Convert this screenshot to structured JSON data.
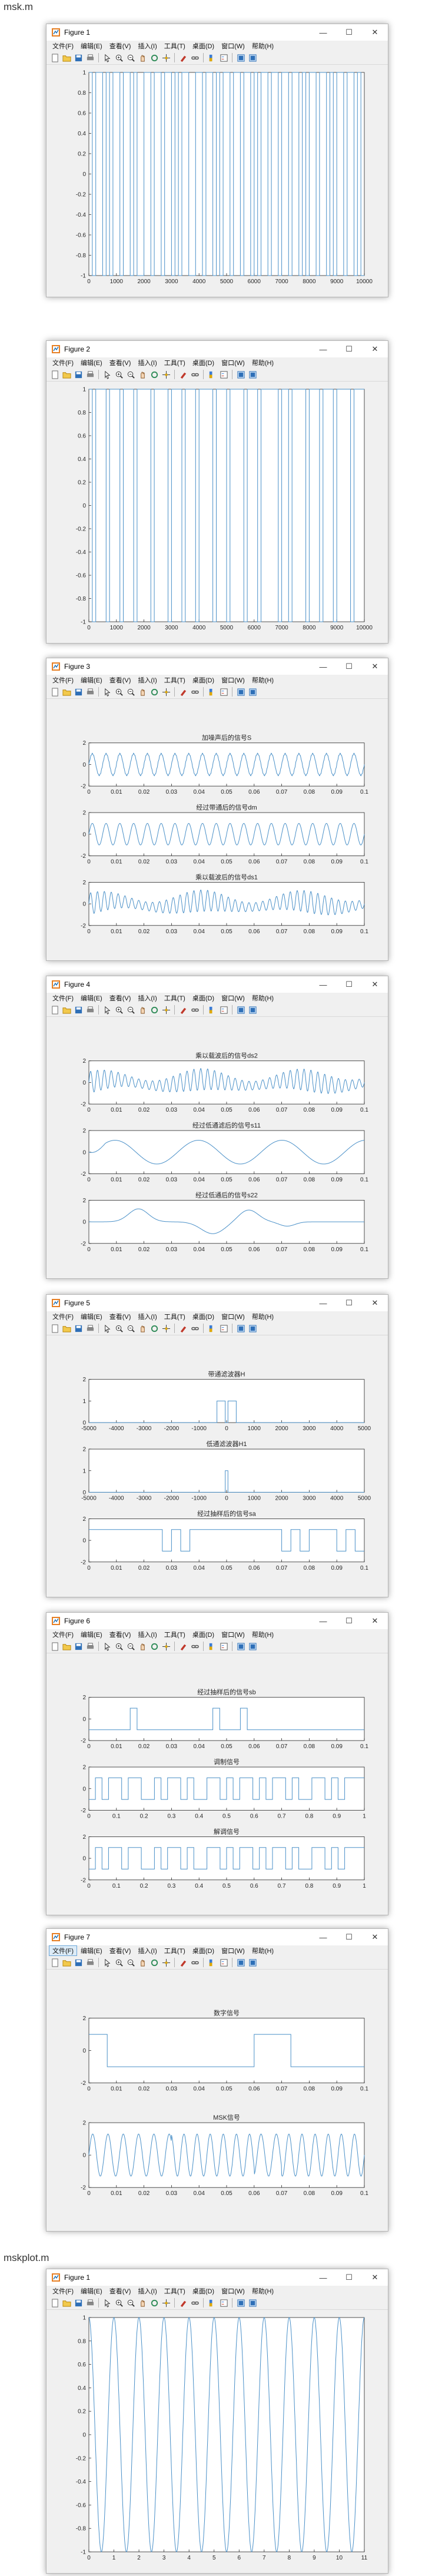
{
  "labels": {
    "file1": "msk.m",
    "file2": "mskplot.m"
  },
  "menu": [
    "文件(F)",
    "编辑(E)",
    "查看(V)",
    "插入(I)",
    "工具(T)",
    "桌面(D)",
    "窗口(W)",
    "帮助(H)"
  ],
  "toolbar_icons": [
    "new-icon",
    "open-icon",
    "save-icon",
    "print-icon",
    "pointer-icon",
    "zoom-in-icon",
    "zoom-out-icon",
    "pan-icon",
    "rotate-icon",
    "data-cursor-icon",
    "brush-icon",
    "link-icon",
    "colorbar-icon",
    "legend-icon",
    "hide-plot-tools-icon",
    "show-plot-tools-icon"
  ],
  "window_controls": {
    "minimize": "—",
    "maximize": "☐",
    "close": "✕"
  },
  "colors": {
    "line": "#4a90c8",
    "window_bg": "#f0f0f0",
    "axes_bg": "#ffffff"
  },
  "figures": [
    {
      "title": "Figure 1",
      "axes": [
        {
          "title": "",
          "type": "bits",
          "xlim": [
            0,
            10000
          ],
          "ylim": [
            -1,
            1
          ],
          "xticks": [
            "0",
            "1000",
            "2000",
            "3000",
            "4000",
            "5000",
            "6000",
            "7000",
            "8000",
            "9000",
            "10000"
          ],
          "yticks": [
            "-1",
            "-0.8",
            "-0.6",
            "-0.4",
            "-0.2",
            "0",
            "0.2",
            "0.4",
            "0.6",
            "0.8",
            "1"
          ],
          "bits": [
            1,
            0,
            1,
            1,
            0,
            1,
            0,
            1,
            1,
            0,
            1,
            1,
            0,
            1,
            0,
            0,
            1,
            1,
            0,
            1,
            1,
            0,
            1,
            1,
            0,
            1,
            0,
            1,
            1,
            0,
            0,
            1,
            1,
            0,
            1,
            1,
            0,
            1,
            0,
            1,
            1,
            0,
            1,
            1,
            0,
            1,
            1,
            0,
            1,
            0,
            1,
            1,
            0,
            1,
            1,
            0,
            1,
            1,
            0,
            1,
            1,
            0,
            1,
            0,
            1,
            1,
            0,
            1,
            1,
            0,
            1,
            0,
            1,
            1,
            0,
            1,
            1,
            0,
            1,
            0
          ]
        }
      ]
    },
    {
      "title": "Figure 2",
      "axes": [
        {
          "title": "",
          "type": "bits",
          "xlim": [
            0,
            10000
          ],
          "ylim": [
            -1,
            1
          ],
          "xticks": [
            "0",
            "1000",
            "2000",
            "3000",
            "4000",
            "5000",
            "6000",
            "7000",
            "8000",
            "9000",
            "10000"
          ],
          "yticks": [
            "-1",
            "-0.8",
            "-0.6",
            "-0.4",
            "-0.2",
            "0",
            "0.2",
            "0.4",
            "0.6",
            "0.8",
            "1"
          ],
          "bits": [
            1,
            0,
            1,
            1,
            1,
            0,
            1,
            1,
            1,
            0,
            1,
            1,
            1,
            0,
            1,
            1,
            1,
            1,
            0,
            1,
            1,
            1,
            1,
            0,
            1,
            1,
            1,
            0,
            1,
            1,
            1,
            0,
            1,
            1,
            1,
            1,
            0,
            1,
            1,
            1,
            0,
            1,
            1,
            1,
            1,
            0,
            1,
            1,
            1,
            0,
            1,
            1,
            1,
            1,
            1,
            0,
            1,
            1,
            0,
            1,
            1,
            1,
            1,
            0,
            1,
            1,
            1,
            0,
            1,
            1,
            1,
            0,
            1,
            1,
            1,
            1,
            0,
            1,
            1,
            1
          ]
        }
      ]
    },
    {
      "title": "Figure 3",
      "axes": [
        {
          "title": "加噪声后的信号S",
          "type": "wave",
          "variant": "sine_noisy",
          "xlim": [
            0,
            0.1
          ],
          "ylim": [
            -2,
            2
          ],
          "xticks": [
            "0",
            "0.01",
            "0.02",
            "0.03",
            "0.04",
            "0.05",
            "0.06",
            "0.07",
            "0.08",
            "0.09",
            "0.1"
          ],
          "yticks": [
            "-2",
            "0",
            "2"
          ]
        },
        {
          "title": "经过带通后的信号dm",
          "type": "wave",
          "variant": "sine",
          "xlim": [
            0,
            0.1
          ],
          "ylim": [
            -2,
            2
          ],
          "xticks": [
            "0",
            "0.01",
            "0.02",
            "0.03",
            "0.04",
            "0.05",
            "0.06",
            "0.07",
            "0.08",
            "0.09",
            "0.1"
          ],
          "yticks": [
            "-2",
            "0",
            "2"
          ]
        },
        {
          "title": "乘以载波后的信号ds1",
          "type": "wave",
          "variant": "mixed",
          "xlim": [
            0,
            0.1
          ],
          "ylim": [
            -2,
            2
          ],
          "xticks": [
            "0",
            "0.01",
            "0.02",
            "0.03",
            "0.04",
            "0.05",
            "0.06",
            "0.07",
            "0.08",
            "0.09",
            "0.1"
          ],
          "yticks": [
            "-2",
            "0",
            "2"
          ]
        }
      ]
    },
    {
      "title": "Figure 4",
      "axes": [
        {
          "title": "乘以载波后的信号ds2",
          "type": "wave",
          "variant": "mixed",
          "xlim": [
            0,
            0.1
          ],
          "ylim": [
            -2,
            2
          ],
          "xticks": [
            "0",
            "0.01",
            "0.02",
            "0.03",
            "0.04",
            "0.05",
            "0.06",
            "0.07",
            "0.08",
            "0.09",
            "0.1"
          ],
          "yticks": [
            "-2",
            "0",
            "2"
          ]
        },
        {
          "title": "经过低通滤后的信号s11",
          "type": "wave",
          "variant": "slow",
          "xlim": [
            0,
            0.1
          ],
          "ylim": [
            -2,
            2
          ],
          "xticks": [
            "0",
            "0.01",
            "0.02",
            "0.03",
            "0.04",
            "0.05",
            "0.06",
            "0.07",
            "0.08",
            "0.09",
            "0.1"
          ],
          "yticks": [
            "-2",
            "0",
            "2"
          ]
        },
        {
          "title": "经过低通后的信号s22",
          "type": "wave",
          "variant": "bumps",
          "xlim": [
            0,
            0.1
          ],
          "ylim": [
            -2,
            2
          ],
          "xticks": [
            "0",
            "0.01",
            "0.02",
            "0.03",
            "0.04",
            "0.05",
            "0.06",
            "0.07",
            "0.08",
            "0.09",
            "0.1"
          ],
          "yticks": [
            "-2",
            "0",
            "2"
          ]
        }
      ]
    },
    {
      "title": "Figure 5",
      "axes": [
        {
          "title": "带通滤波器H",
          "type": "filter",
          "variant": "bandpass",
          "xlim": [
            -5000,
            5000
          ],
          "ylim": [
            0,
            2
          ],
          "xticks": [
            "-5000",
            "-4000",
            "-3000",
            "-2000",
            "-1000",
            "0",
            "1000",
            "2000",
            "3000",
            "4000",
            "5000"
          ],
          "yticks": [
            "0",
            "1",
            "2"
          ]
        },
        {
          "title": "低通滤波器H1",
          "type": "filter",
          "variant": "lowpass",
          "xlim": [
            -5000,
            5000
          ],
          "ylim": [
            0,
            2
          ],
          "xticks": [
            "-5000",
            "-4000",
            "-3000",
            "-2000",
            "-1000",
            "0",
            "1000",
            "2000",
            "3000",
            "4000",
            "5000"
          ],
          "yticks": [
            "0",
            "1",
            "2"
          ]
        },
        {
          "title": "经过抽样后的信号sa",
          "type": "square",
          "levels": [
            1,
            1,
            1,
            1,
            1,
            1,
            1,
            1,
            -1,
            1,
            -1,
            1,
            1,
            1,
            1,
            1,
            1,
            1,
            1,
            1,
            1,
            -1,
            1,
            -1,
            1,
            1,
            1,
            -1,
            1,
            -1
          ],
          "xlim": [
            0,
            0.1
          ],
          "ylim": [
            -2,
            2
          ],
          "xticks": [
            "0",
            "0.01",
            "0.02",
            "0.03",
            "0.04",
            "0.05",
            "0.06",
            "0.07",
            "0.08",
            "0.09",
            "0.1"
          ],
          "yticks": [
            "-2",
            "0",
            "2"
          ]
        }
      ]
    },
    {
      "title": "Figure 6",
      "axes": [
        {
          "title": "经过抽样后的信号sb",
          "type": "square",
          "levels": [
            -1,
            -1,
            -1,
            -1,
            -1,
            -1,
            1,
            -1,
            -1,
            -1,
            -1,
            -1,
            -1,
            -1,
            -1,
            -1,
            -1,
            -1,
            1,
            -1,
            -1,
            -1,
            1,
            -1,
            -1,
            -1,
            -1,
            -1,
            -1,
            -1,
            -1,
            -1,
            -1,
            -1,
            -1,
            -1,
            -1,
            -1,
            -1,
            -1
          ],
          "xlim": [
            0,
            0.1
          ],
          "ylim": [
            -2,
            2
          ],
          "xticks": [
            "0",
            "0.01",
            "0.02",
            "0.03",
            "0.04",
            "0.05",
            "0.06",
            "0.07",
            "0.08",
            "0.09",
            "0.1"
          ],
          "yticks": [
            "-2",
            "0",
            "2"
          ]
        },
        {
          "title": "调制信号",
          "type": "square",
          "levels": [
            -1,
            1,
            -1,
            1,
            1,
            -1,
            1,
            1,
            -1,
            -1,
            1,
            -1,
            1,
            1,
            -1,
            1,
            -1,
            -1,
            1,
            1,
            -1,
            1,
            -1,
            1,
            1,
            -1,
            1,
            -1,
            1,
            1,
            -1,
            1,
            -1,
            -1,
            1,
            1,
            -1,
            1,
            -1,
            1,
            1,
            1
          ],
          "xlim": [
            0,
            1
          ],
          "ylim": [
            -2,
            2
          ],
          "xticks": [
            "0",
            "0.1",
            "0.2",
            "0.3",
            "0.4",
            "0.5",
            "0.6",
            "0.7",
            "0.8",
            "0.9",
            "1"
          ],
          "yticks": [
            "-2",
            "0",
            "2"
          ]
        },
        {
          "title": "解调信号",
          "type": "square",
          "levels": [
            -1,
            1,
            -1,
            1,
            1,
            -1,
            1,
            1,
            -1,
            -1,
            1,
            -1,
            1,
            1,
            -1,
            1,
            -1,
            -1,
            1,
            1,
            -1,
            1,
            -1,
            1,
            1,
            -1,
            1,
            -1,
            1,
            1,
            -1,
            1,
            -1,
            -1,
            1,
            1,
            -1,
            1,
            -1,
            1,
            1,
            1
          ],
          "xlim": [
            0,
            1
          ],
          "ylim": [
            -2,
            2
          ],
          "xticks": [
            "0",
            "0.1",
            "0.2",
            "0.3",
            "0.4",
            "0.5",
            "0.6",
            "0.7",
            "0.8",
            "0.9",
            "1"
          ],
          "yticks": [
            "-2",
            "0",
            "2"
          ]
        }
      ]
    },
    {
      "title": "Figure 7",
      "axes": [
        {
          "title": "数字信号",
          "type": "square",
          "levels": [
            1,
            1,
            -1,
            -1,
            -1,
            -1,
            -1,
            -1,
            -1,
            -1,
            -1,
            -1,
            -1,
            -1,
            -1,
            -1,
            -1,
            -1,
            1,
            1,
            1,
            1,
            -1,
            -1,
            -1,
            -1,
            -1,
            -1,
            -1,
            -1
          ],
          "xlim": [
            0,
            0.1
          ],
          "ylim": [
            -2,
            2
          ],
          "xticks": [
            "0",
            "0.01",
            "0.02",
            "0.03",
            "0.04",
            "0.05",
            "0.06",
            "0.07",
            "0.08",
            "0.09",
            "0.1"
          ],
          "yticks": [
            "-2",
            "0",
            "2"
          ]
        },
        {
          "title": "MSK信号",
          "type": "wave",
          "variant": "msk",
          "xlim": [
            0,
            0.1
          ],
          "ylim": [
            -2,
            2
          ],
          "xticks": [
            "0",
            "0.01",
            "0.02",
            "0.03",
            "0.04",
            "0.05",
            "0.06",
            "0.07",
            "0.08",
            "0.09",
            "0.1"
          ],
          "yticks": [
            "-2",
            "0",
            "2"
          ]
        }
      ]
    },
    {
      "title": "Figure 1",
      "axes": [
        {
          "title": "",
          "type": "wave",
          "variant": "cos11",
          "xlim": [
            0,
            11
          ],
          "ylim": [
            -1,
            1
          ],
          "xticks": [
            "0",
            "1",
            "2",
            "3",
            "4",
            "5",
            "6",
            "7",
            "8",
            "9",
            "10",
            "11"
          ],
          "yticks": [
            "-1",
            "-0.8",
            "-0.6",
            "-0.4",
            "-0.2",
            "0",
            "0.2",
            "0.4",
            "0.6",
            "0.8",
            "1"
          ]
        }
      ]
    }
  ]
}
